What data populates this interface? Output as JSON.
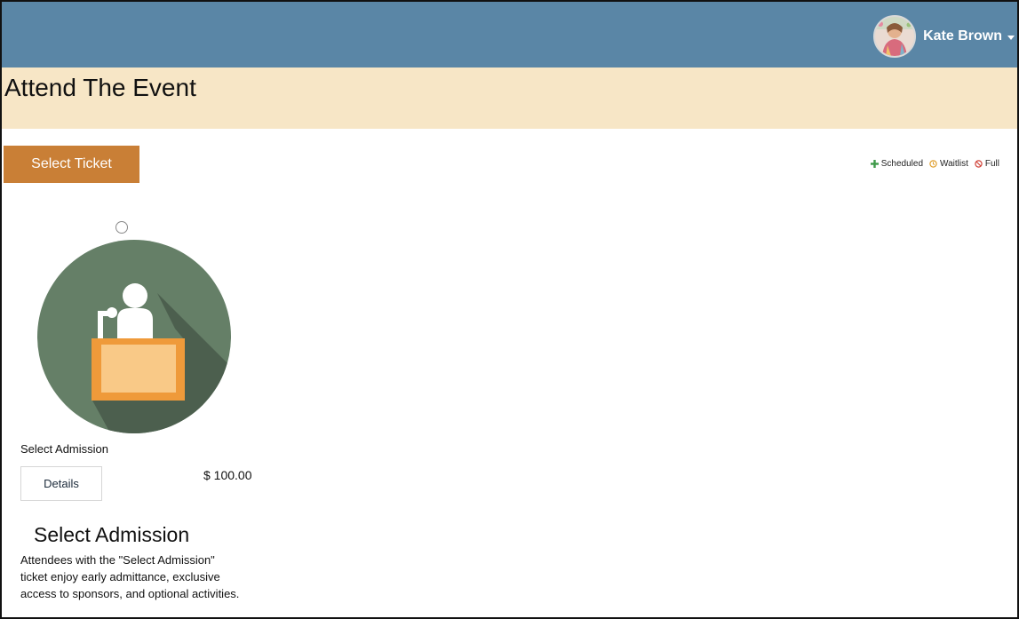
{
  "header": {
    "user_name": "Kate Brown",
    "avatar_icon": "user-avatar",
    "background_color": "#5a86a6"
  },
  "banner": {
    "title": "Attend The Event",
    "background_color": "#f7e6c6"
  },
  "toolbar": {
    "select_ticket_label": "Select Ticket",
    "button_color": "#c97f36"
  },
  "legend": {
    "items": [
      {
        "label": "Scheduled",
        "icon": "plus-icon",
        "color": "#3f9a4a"
      },
      {
        "label": "Waitlist",
        "icon": "clock-icon",
        "color": "#e0a030"
      },
      {
        "label": "Full",
        "icon": "no-entry-icon",
        "color": "#d0443a"
      }
    ]
  },
  "ticket": {
    "name": "Select Admission",
    "details_label": "Details",
    "price": "$ 100.00",
    "selected": false,
    "image_icon": "speaker-podium-icon",
    "description_title": "Select Admission",
    "description": "Attendees with the \"Select Admission\" ticket enjoy early admittance, exclusive access to sponsors, and optional activities."
  }
}
